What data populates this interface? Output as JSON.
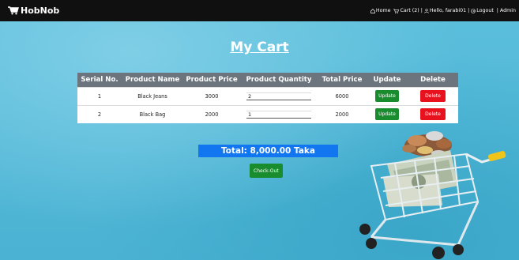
{
  "navbar": {
    "brand": "HobNob",
    "links": {
      "home": "Home",
      "cart": "Cart (2)",
      "user": "Hello, farabi01",
      "logout": "Logout",
      "admin": "Admin"
    },
    "separator": "|"
  },
  "page_title": "My Cart",
  "table": {
    "headers": [
      "Serial No.",
      "Product Name",
      "Product Price",
      "Product Quantity",
      "Total Price",
      "Update",
      "Delete"
    ],
    "rows": [
      {
        "serial": "1",
        "name": "Black Jeans",
        "price": "3000",
        "quantity": "2",
        "total": "6000",
        "update_label": "Update",
        "delete_label": "Delete"
      },
      {
        "serial": "2",
        "name": "Black Bag",
        "price": "2000",
        "quantity": "1",
        "total": "2000",
        "update_label": "Update",
        "delete_label": "Delete"
      }
    ]
  },
  "summary": {
    "total": "Total: 8,000.00 Taka",
    "checkout_label": "Check-Out"
  },
  "colors": {
    "navbar": "#101010",
    "background": "#4fb6d6",
    "table_header": "#6c757d",
    "update_button": "#198d2e",
    "delete_button": "#e8121e",
    "total_banner": "#1276f0"
  },
  "icons": {
    "brand": "shopping-cart-icon",
    "home": "home-icon",
    "cart": "cart-icon",
    "user": "user-icon",
    "logout": "logout-icon"
  }
}
